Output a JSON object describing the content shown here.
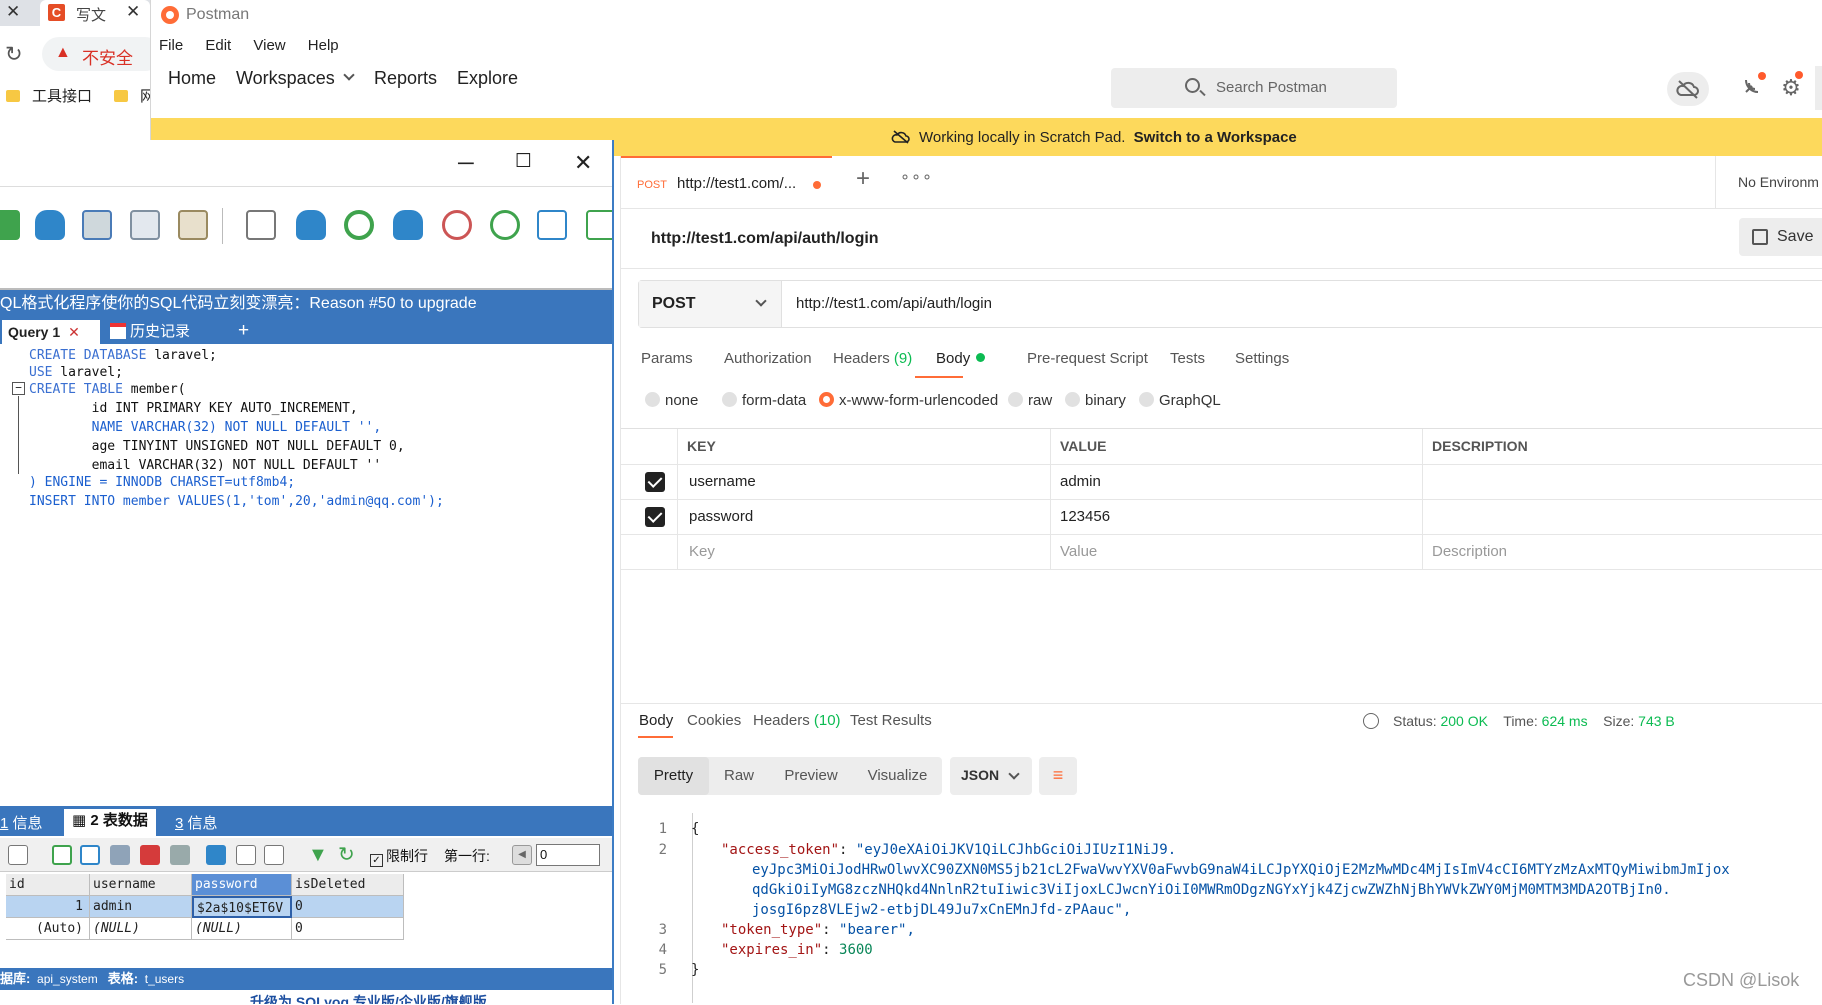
{
  "chrome": {
    "tab_title": "写文",
    "security_label": "不安全",
    "bookmarks": [
      "工具接口",
      "网"
    ]
  },
  "postman": {
    "app_title": "Postman",
    "menu": [
      "File",
      "Edit",
      "View",
      "Help"
    ],
    "nav": [
      "Home",
      "Workspaces",
      "Reports",
      "Explore"
    ],
    "search_placeholder": "Search Postman",
    "banner_text": "Working locally in Scratch Pad.",
    "banner_link": "Switch to a Workspace",
    "request_tab": {
      "method": "POST",
      "url": "http://test1.com/..."
    },
    "environment": "No Environm",
    "request_title": "http://test1.com/api/auth/login",
    "save_label": "Save",
    "method": "POST",
    "url": "http://test1.com/api/auth/login",
    "request_tabs": {
      "params": "Params",
      "authorization": "Authorization",
      "headers_label": "Headers",
      "headers_count": "(9)",
      "body": "Body",
      "prerequest": "Pre-request Script",
      "tests": "Tests",
      "settings": "Settings"
    },
    "body_modes": [
      "none",
      "form-data",
      "x-www-form-urlencoded",
      "raw",
      "binary",
      "GraphQL"
    ],
    "body_mode_selected": "x-www-form-urlencoded",
    "kv_headers": [
      "KEY",
      "VALUE",
      "DESCRIPTION"
    ],
    "kv_rows": [
      {
        "checked": true,
        "key": "username",
        "value": "admin"
      },
      {
        "checked": true,
        "key": "password",
        "value": "123456"
      }
    ],
    "kv_placeholders": {
      "key": "Key",
      "value": "Value",
      "description": "Description"
    },
    "response_tabs": {
      "body": "Body",
      "cookies": "Cookies",
      "headers_label": "Headers",
      "headers_count": "(10)",
      "test_results": "Test Results"
    },
    "status": {
      "label": "Status:",
      "value": "200 OK",
      "time_label": "Time:",
      "time_value": "624 ms",
      "size_label": "Size:",
      "size_value": "743 B"
    },
    "view_modes": [
      "Pretty",
      "Raw",
      "Preview",
      "Visualize"
    ],
    "view_selected": "Pretty",
    "format": "JSON",
    "response_lines": [
      {
        "n": "1",
        "text": "{"
      },
      {
        "n": "2",
        "key": "\"access_token\"",
        "value": "\"eyJ0eXAiOiJKV1QiLCJhbGciOiJIUzI1NiJ9."
      },
      {
        "n": "",
        "value": "eyJpc3MiOiJodHRwOlwvXC90ZXN0MS5jb21cL2FwaVwvYXV0aFwvbG9naW4iLCJpYXQiOjE2MzMwMDc4MjIsImV4cCI6MTYzMzAxMTQyMiwibmJmIjox"
      },
      {
        "n": "",
        "value": "qdGkiOiIyMG8zczNHQkd4NnlnR2tuIiwic3ViIjoxLCJwcnYiOiI0MWRmODgzNGYxYjk4ZjcwZWZhNjBhYWVkZWY0MjM0MTM3MDA2OTBjIn0."
      },
      {
        "n": "",
        "value": "josgI6pz8VLEjw2-etbjDL49Ju7xCnEMnJfd-zPAauc\","
      },
      {
        "n": "3",
        "key": "\"token_type\"",
        "value": "\"bearer\","
      },
      {
        "n": "4",
        "key": "\"expires_in\"",
        "value": "3600"
      },
      {
        "n": "5",
        "text": "}"
      }
    ],
    "colors": {
      "accent": "#ff6c37",
      "success": "#0cbb52",
      "banner": "#fdd95c"
    }
  },
  "sqlyog": {
    "promo": "QL格式化程序使你的SQL代码立刻变漂亮：Reason #50 to upgrade",
    "query_tab": "Query 1",
    "history_tab": "历史记录",
    "sql_lines": [
      {
        "kind": "kwline",
        "kw": "CREATE DATABASE",
        "rest": " laravel;"
      },
      {
        "kind": "kwline",
        "kw": "USE",
        "rest": " laravel;"
      },
      {
        "kind": "kwline",
        "kw": "CREATE TABLE",
        "rest": " member("
      },
      {
        "kind": "col",
        "text": "        id INT PRIMARY KEY AUTO_INCREMENT,"
      },
      {
        "kind": "col",
        "text": "        NAME VARCHAR(32) NOT NULL DEFAULT '',"
      },
      {
        "kind": "col",
        "text": "        age TINYINT UNSIGNED NOT NULL DEFAULT 0,"
      },
      {
        "kind": "col",
        "text": "        email VARCHAR(32) NOT NULL DEFAULT ''"
      },
      {
        "kind": "plain",
        "text": ") ENGINE = INNODB CHARSET=utf8mb4;"
      },
      {
        "kind": "plain",
        "text": "INSERT INTO member VALUES(1,'tom',20,'admin@qq.com');"
      }
    ],
    "result_tabs": [
      {
        "num": "1",
        "label": "信息"
      },
      {
        "num": "2",
        "label": "表数据"
      },
      {
        "num": "3",
        "label": "信息"
      }
    ],
    "limit_label": "限制行",
    "first_row_label": "第一行:",
    "first_row_value": "0",
    "grid_headers": [
      "id",
      "username",
      "password",
      "isDeleted"
    ],
    "grid_rows": [
      [
        "1",
        "admin",
        "$2a$10$ET6V",
        "0"
      ],
      [
        "(Auto)",
        "(NULL)",
        "(NULL)",
        "0"
      ]
    ],
    "status_db_label": "据库:",
    "status_db": "api_system",
    "status_table_label": "表格:",
    "status_table": "t_users",
    "upgrade": "升级为 SQLyog 专业版/企业版/旗舰版"
  },
  "watermark": "CSDN @Lisok"
}
